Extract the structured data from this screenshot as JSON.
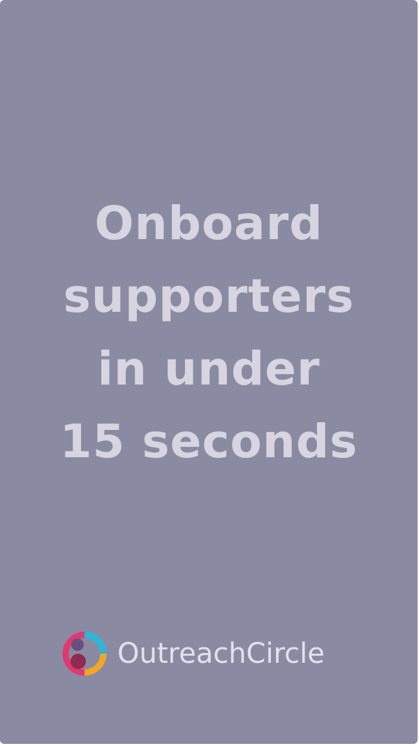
{
  "headline": {
    "line1": "Onboard",
    "line2": "supporters",
    "line3": "in under",
    "line4": "15 seconds"
  },
  "brand": {
    "name": "OutreachCircle",
    "icon": "outreachcircle-logo-icon"
  },
  "colors": {
    "background": "#8a8aa3",
    "headline_text": "#d6d5e0",
    "logo_teal": "#2ab7d8",
    "logo_orange": "#f2a623",
    "logo_pink": "#e0386f",
    "logo_maroon": "#8e2b4e"
  }
}
